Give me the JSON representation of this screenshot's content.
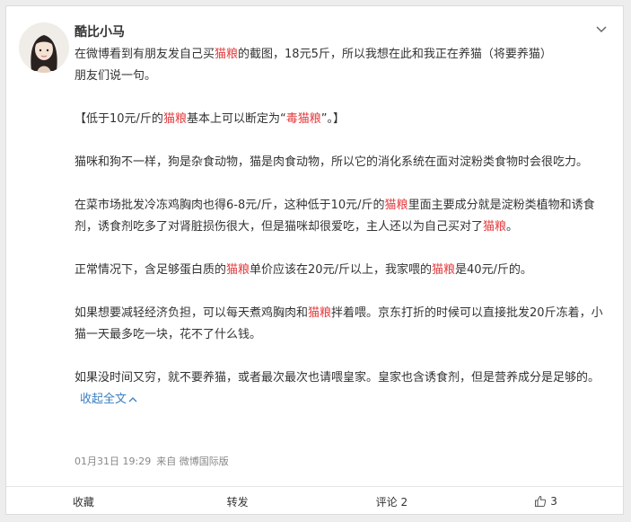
{
  "post": {
    "username": "酷比小马",
    "intro_a": "在微博看到有朋友发自己买",
    "intro_kw": "猫粮",
    "intro_b": "的截图，18元5斤，所以我想在此和我正在养猫（将要养猫）",
    "intro_c": "朋友们说一句。",
    "p2_a": "【低于10元/斤的",
    "p2_kw": "猫粮",
    "p2_b": "基本上可以断定为“",
    "p2_kw2": "毒猫粮",
    "p2_c": "”。】",
    "p3": "猫咪和狗不一样，狗是杂食动物，猫是肉食动物，所以它的消化系统在面对淀粉类食物时会很吃力。",
    "p4_a": "在菜市场批发冷冻鸡胸肉也得6-8元/斤，这种低于10元/斤的",
    "p4_kw": "猫粮",
    "p4_b": "里面主要成分就是淀粉类植物和诱食剂，诱食剂吃多了对肾脏损伤很大，但是猫咪却很爱吃，主人还以为自己买对了",
    "p4_kw2": "猫粮",
    "p4_c": "。",
    "p5_a": "正常情况下，含足够蛋白质的",
    "p5_kw": "猫粮",
    "p5_b": "单价应该在20元/斤以上，我家喂的",
    "p5_kw2": "猫粮",
    "p5_c": "是40元/斤的。",
    "p6_a": "如果想要减轻经济负担，可以每天煮鸡胸肉和",
    "p6_kw": "猫粮",
    "p6_b": "拌着喂。京东打折的时候可以直接批发20斤冻着，小猫一天最多吃一块，花不了什么钱。",
    "p7": "如果没时间又穷，就不要养猫，或者最次最次也请喂皇家。皇家也含诱食剂，但是营养成分是足够的。",
    "expand_label": "收起全文",
    "time": "01月31日 19:29",
    "source": "来自 微博国际版"
  },
  "actions": {
    "favorite": "收藏",
    "repost": "转发",
    "comment": "评论 2",
    "like_count": "3"
  },
  "colors": {
    "keyword": "#e4393c",
    "link": "#3a7fc1"
  }
}
